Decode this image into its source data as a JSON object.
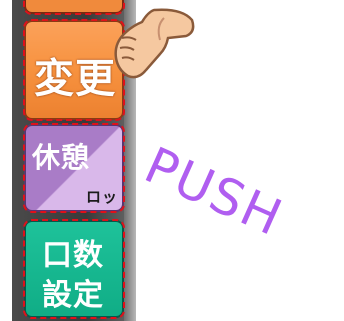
{
  "buttons": {
    "change": {
      "label": "変更"
    },
    "rest": {
      "label": "休憩",
      "sub_label": "ロック"
    },
    "count": {
      "line1": "口数",
      "line2": "設定"
    }
  },
  "overlay": {
    "push_text": "PUSH"
  },
  "colors": {
    "change": "#f7923f",
    "rest": "#a97cc7",
    "count": "#10ad86",
    "dashed_outline": "#e0101a",
    "push": "#b05ef0"
  },
  "icons": {
    "hand": "pointing-hand-icon"
  }
}
